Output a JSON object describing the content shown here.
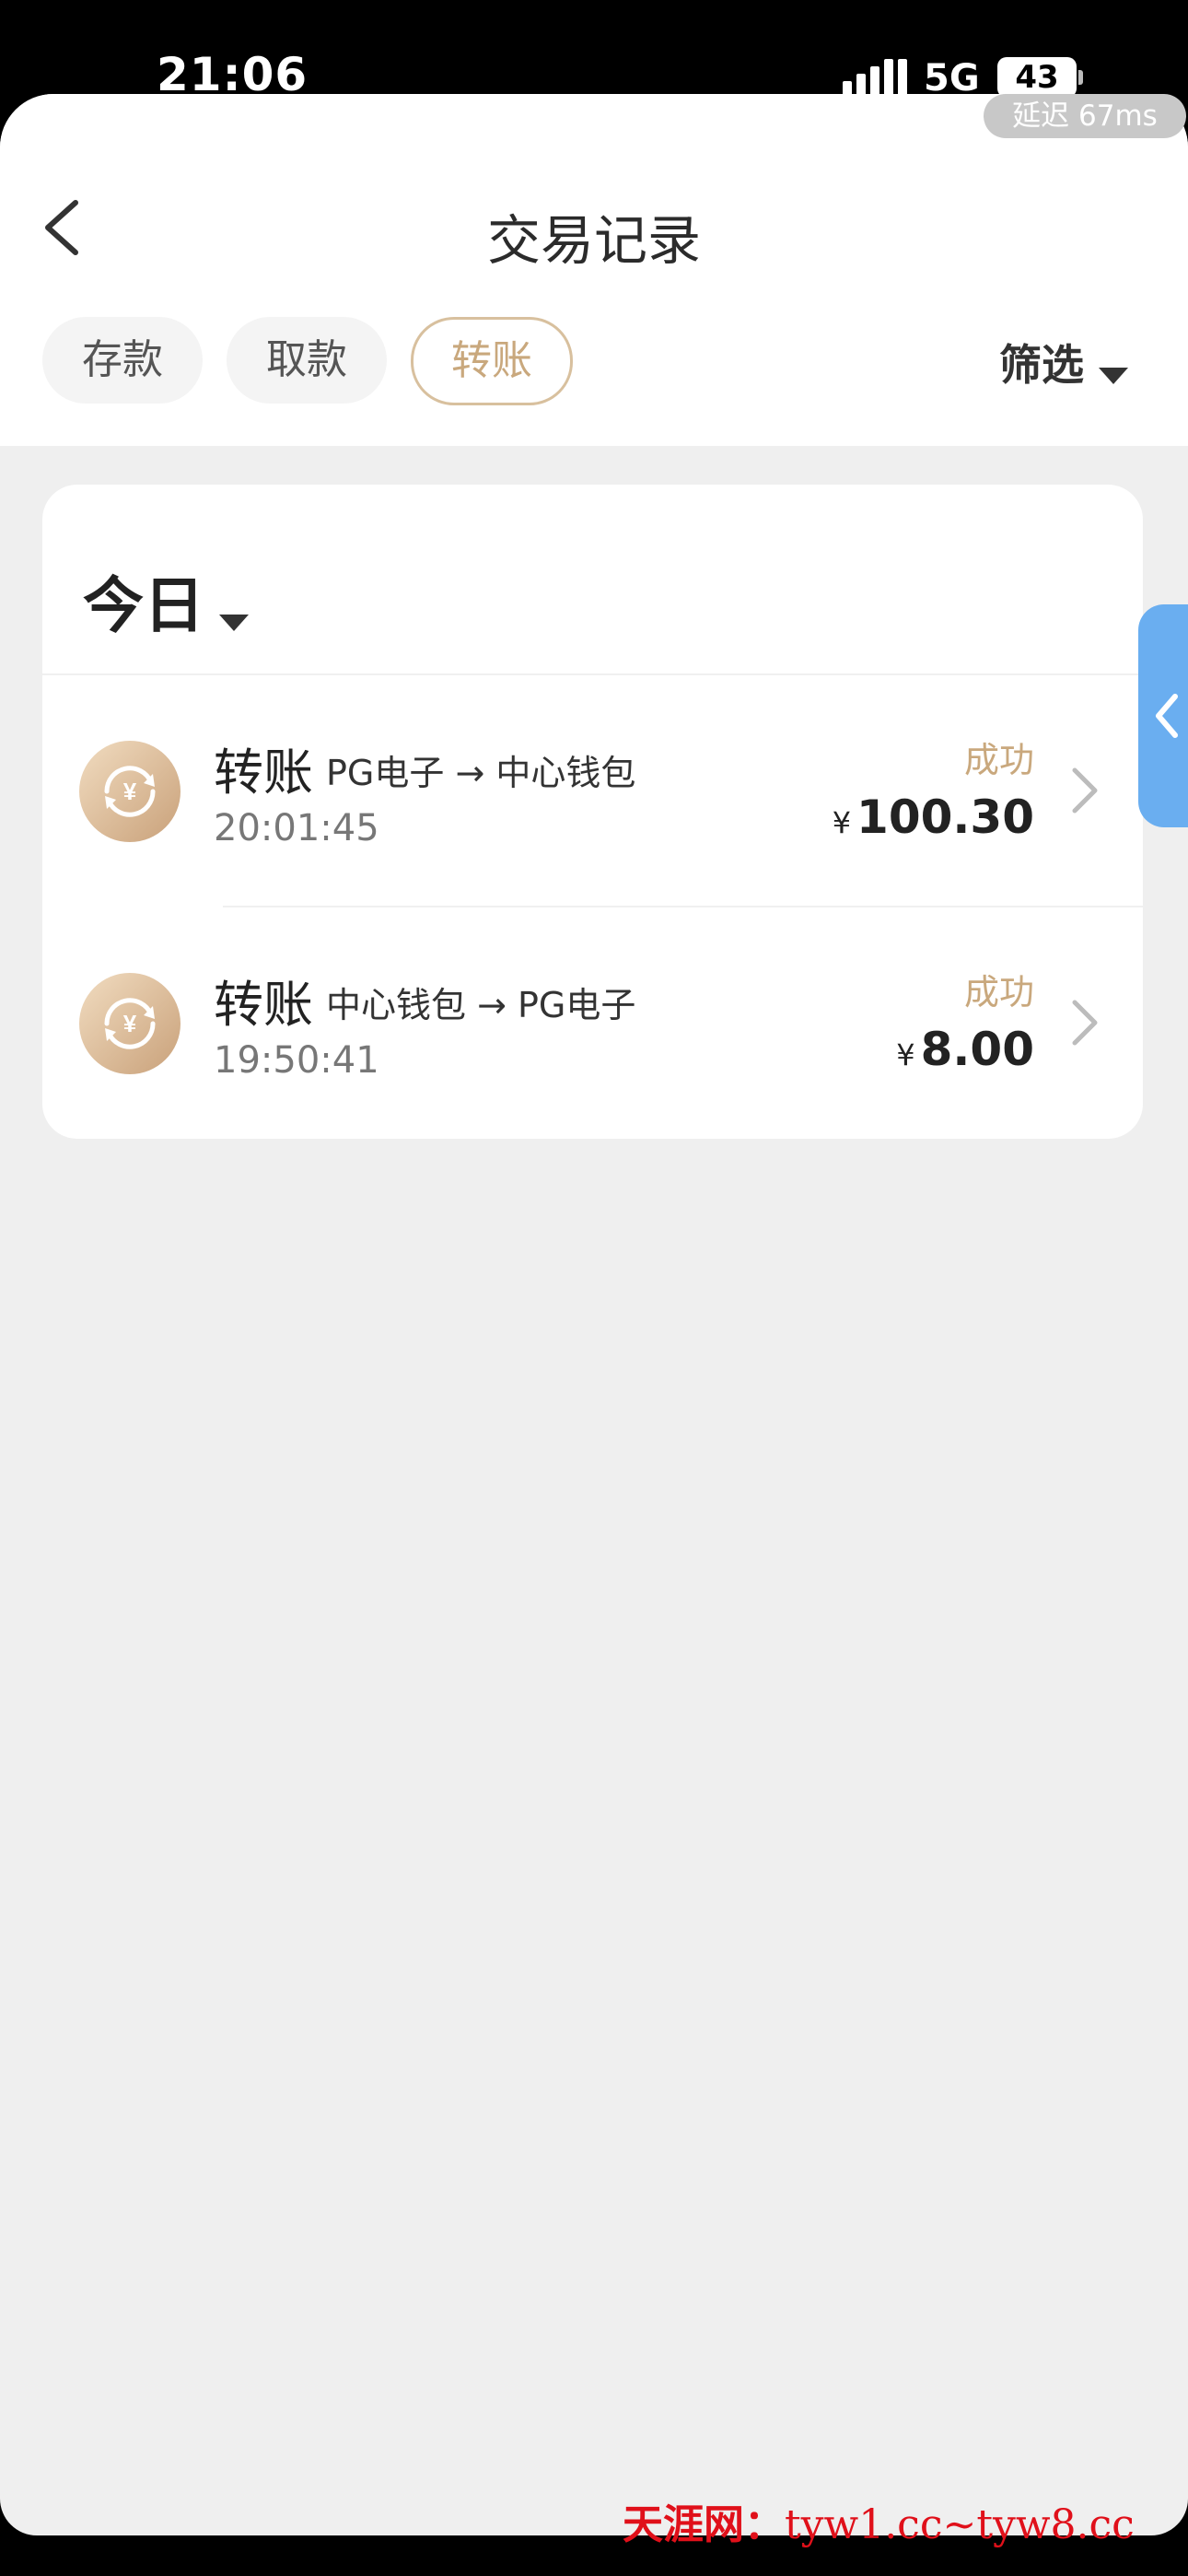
{
  "status_bar": {
    "time": "21:06",
    "network": "5G",
    "battery": "43"
  },
  "latency": "延迟 67ms",
  "header": {
    "title": "交易记录"
  },
  "tabs": [
    {
      "label": "存款"
    },
    {
      "label": "取款"
    },
    {
      "label": "转账",
      "selected": true
    }
  ],
  "filter": {
    "label": "筛选"
  },
  "section": {
    "label": "今日"
  },
  "transactions": [
    {
      "type": "转账",
      "route": "PG电子 → 中心钱包",
      "time": "20:01:45",
      "status": "成功",
      "currency": "¥",
      "amount": "100.30"
    },
    {
      "type": "转账",
      "route": "中心钱包 → PG电子",
      "time": "19:50:41",
      "status": "成功",
      "currency": "¥",
      "amount": "8.00"
    }
  ],
  "watermark": {
    "brand": "天涯网：",
    "url": "tyw1.cc~tyw8.cc"
  },
  "colors": {
    "accent": "#c9a87d",
    "background": "#efefef",
    "side_tab": "#6aaef0",
    "watermark": "#e0101a"
  }
}
